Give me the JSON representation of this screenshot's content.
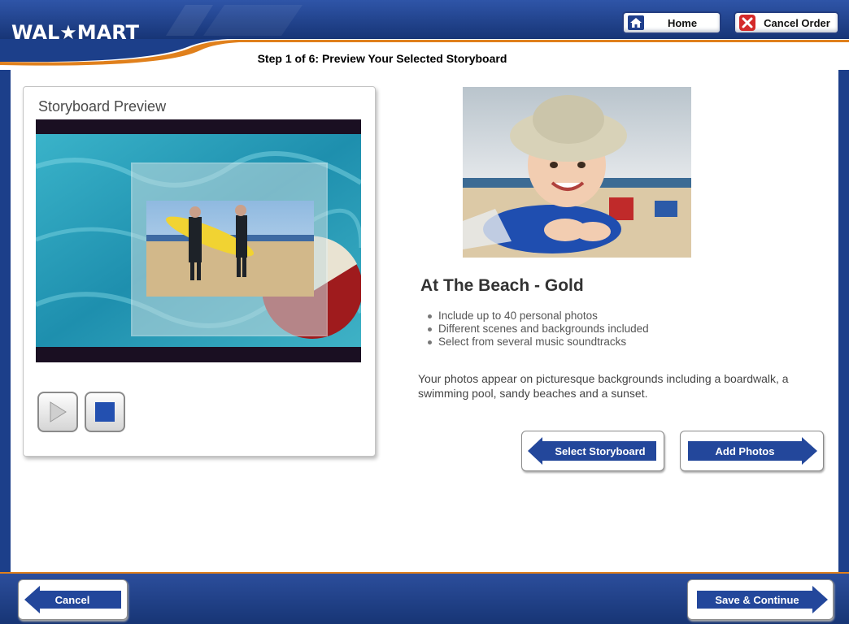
{
  "header": {
    "logo_text": "WAL★MART",
    "step_title": "Step 1 of 6: Preview Your Selected Storyboard",
    "home_label": "Home",
    "cancel_order_label": "Cancel Order"
  },
  "preview": {
    "title": "Storyboard Preview"
  },
  "product": {
    "title": "At The Beach - Gold",
    "features": [
      "Include up to 40 personal photos",
      "Different scenes and backgrounds included",
      "Select from several music soundtracks"
    ],
    "description": " Your photos appear on picturesque backgrounds including a boardwalk, a swimming pool, sandy beaches and a sunset."
  },
  "actions": {
    "select_storyboard_label": "Select Storyboard",
    "add_photos_label": "Add Photos"
  },
  "footer": {
    "cancel_label": "Cancel",
    "save_continue_label": "Save & Continue"
  },
  "colors": {
    "brand_blue": "#1c3f8a",
    "button_blue": "#23479b",
    "accent_orange": "#e0801c",
    "cancel_red": "#d42a2a"
  },
  "icons": {
    "home": "house-icon",
    "cancel_order": "red-x-icon",
    "play": "play-icon",
    "stop": "stop-icon"
  }
}
